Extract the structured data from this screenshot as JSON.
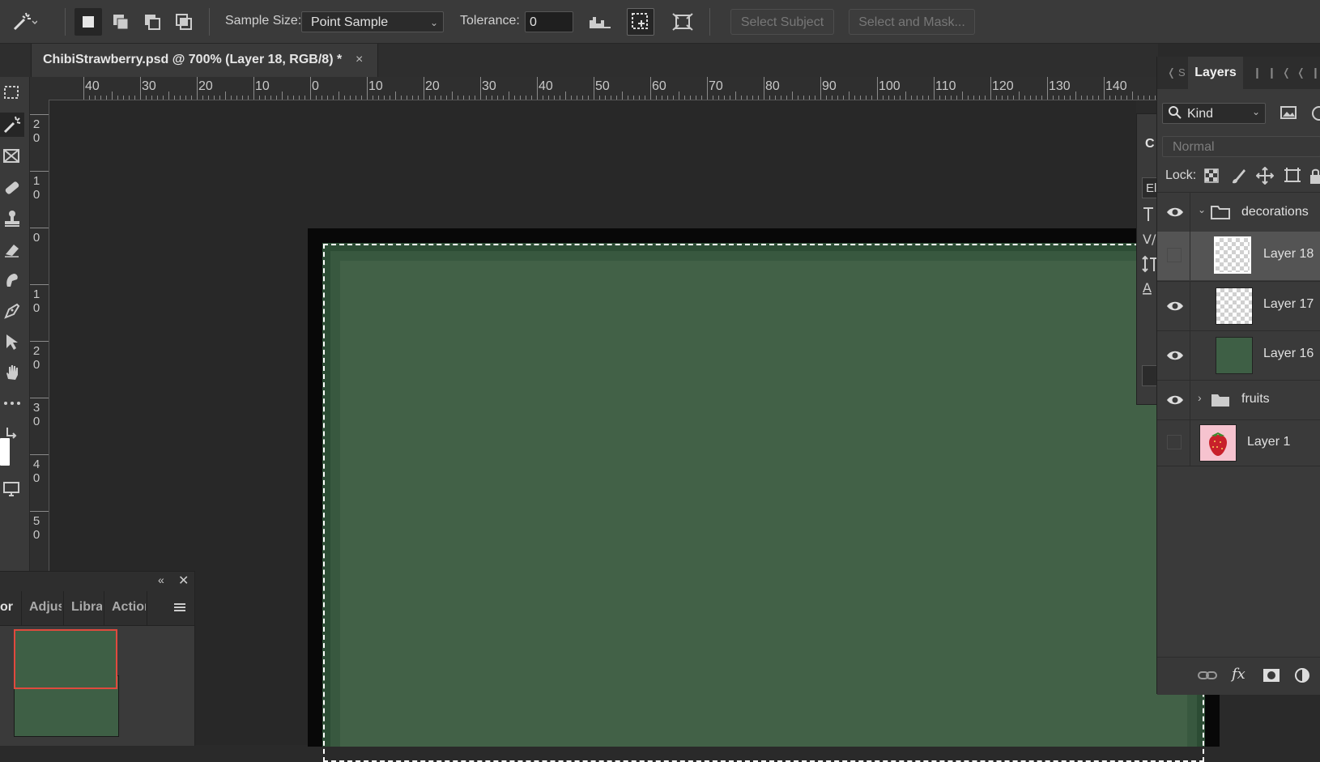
{
  "options_bar": {
    "sample_size_label": "Sample Size:",
    "sample_size_value": "Point Sample",
    "tolerance_label": "Tolerance:",
    "tolerance_value": "0",
    "select_subject": "Select Subject",
    "select_and_mask": "Select and Mask..."
  },
  "document": {
    "tab_title": "ChibiStrawberry.psd @ 700% (Layer 18, RGB/8) *",
    "close_symbol": "×"
  },
  "ruler": {
    "top_labels": [
      "40",
      "30",
      "20",
      "10",
      "0",
      "10",
      "20",
      "30",
      "40",
      "50",
      "60",
      "70",
      "80",
      "90",
      "100",
      "110",
      "120",
      "130",
      "140"
    ],
    "left_labels": [
      [
        "2",
        "0"
      ],
      [
        "1",
        "0"
      ],
      [
        "0"
      ],
      [
        "1",
        "0"
      ],
      [
        "2",
        "0"
      ],
      [
        "3",
        "0"
      ],
      [
        "4",
        "0"
      ],
      [
        "5",
        "0"
      ]
    ]
  },
  "layers_panel": {
    "tab_label": "Layers",
    "filter_kind": "Kind",
    "blend_mode": "Normal",
    "lock_label": "Lock:",
    "layers": [
      {
        "name": "decorations",
        "type": "group",
        "visible": true,
        "expanded": true
      },
      {
        "name": "Layer 18",
        "type": "layer",
        "visible": false,
        "selected": true,
        "thumb": "transparent"
      },
      {
        "name": "Layer 17",
        "type": "layer",
        "visible": true,
        "thumb": "transparent"
      },
      {
        "name": "Layer 16",
        "type": "layer",
        "visible": true,
        "thumb": "#3e5f45"
      },
      {
        "name": "fruits",
        "type": "group",
        "visible": true,
        "expanded": false
      },
      {
        "name": "Layer 1",
        "type": "layer",
        "visible": false,
        "thumb": "strawberry"
      }
    ]
  },
  "character_panel": {
    "letter": "C",
    "row_label": "El"
  },
  "color_panel": {
    "tabs": [
      "or",
      "Adjus",
      "Librar",
      "Action"
    ],
    "foreground": "#3e5f45",
    "background": "#3e5f45"
  }
}
